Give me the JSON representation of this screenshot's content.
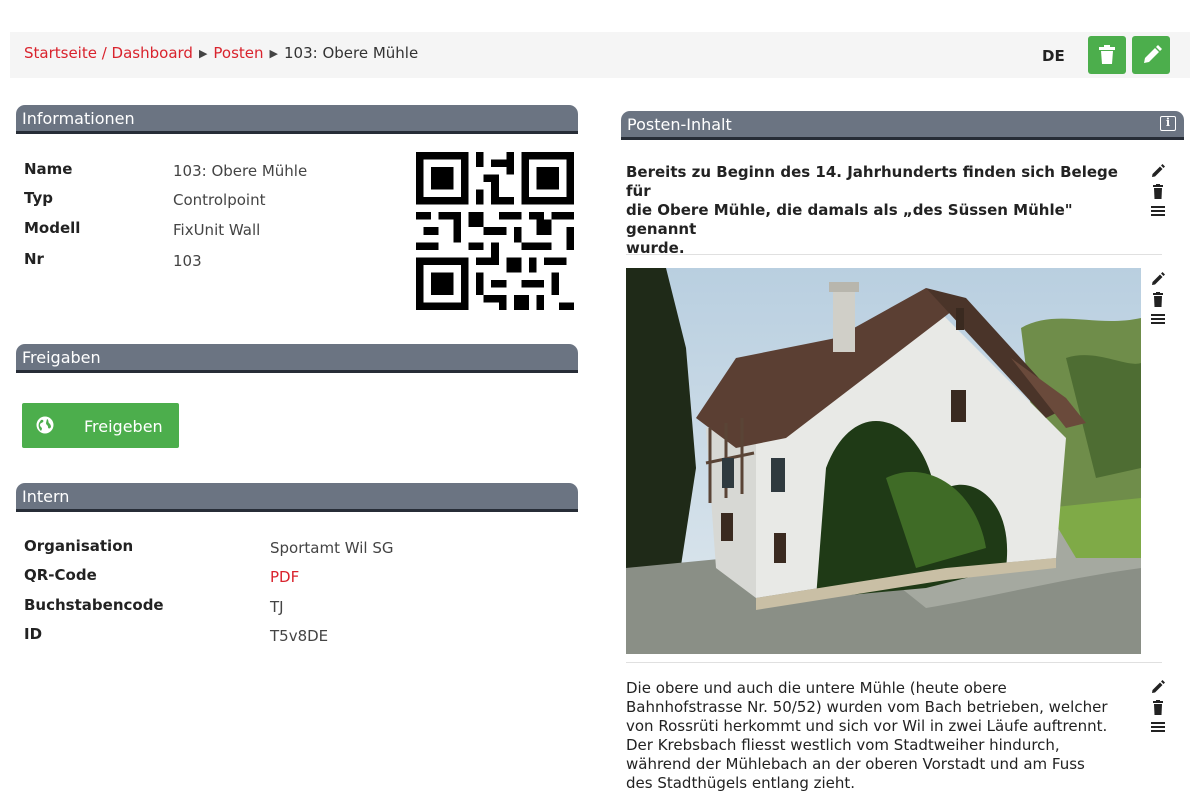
{
  "breadcrumb": {
    "home": "Startseite / Dashboard",
    "posten": "Posten",
    "current": "103: Obere Mühle",
    "separator": "▶"
  },
  "toolbar": {
    "language": "DE",
    "delete_icon": "trash-icon",
    "edit_icon": "pencil-icon",
    "accent_color": "#4cae4c"
  },
  "informationen": {
    "title": "Informationen",
    "rows": [
      {
        "label": "Name",
        "value": "103: Obere Mühle"
      },
      {
        "label": "Typ",
        "value": "Controlpoint"
      },
      {
        "label": "Modell",
        "value": "FixUnit Wall"
      },
      {
        "label": "Nr",
        "value": "103"
      }
    ]
  },
  "freigaben": {
    "title": "Freigaben",
    "button_label": "Freigeben",
    "button_icon": "globe-icon"
  },
  "intern": {
    "title": "Intern",
    "rows": [
      {
        "label": "Organisation",
        "value": "Sportamt Wil SG"
      },
      {
        "label": "QR-Code",
        "value": "PDF"
      },
      {
        "label": "Buchstabencode",
        "value": "TJ"
      },
      {
        "label": "ID",
        "value": "T5v8DE"
      }
    ]
  },
  "posten_inhalt": {
    "title": "Posten-Inhalt",
    "info_icon": "info-icon",
    "block1_lines": [
      "Bereits zu Beginn des 14. Jahrhunderts finden sich Belege für",
      "die Obere Mühle, die damals als „des Süssen Mühle\" genannt",
      "wurde."
    ],
    "block3_lines": [
      "Die obere und auch die untere Mühle (heute obere",
      "Bahnhofstrasse Nr. 50/52) wurden vom Bach betrieben, welcher",
      "von Rossrüti herkommt und sich vor Wil in zwei Läufe auftrennt.",
      "Der Krebsbach fliesst westlich vom Stadtweiher hindurch,",
      "während der Mühlebach an der oberen Vorstadt und am Fuss",
      "des Stadthügels entlang zieht."
    ]
  },
  "colors": {
    "header_bg": "#6b7482",
    "header_border": "#272d37",
    "link": "#d9232d",
    "button_green": "#4cae4c"
  }
}
